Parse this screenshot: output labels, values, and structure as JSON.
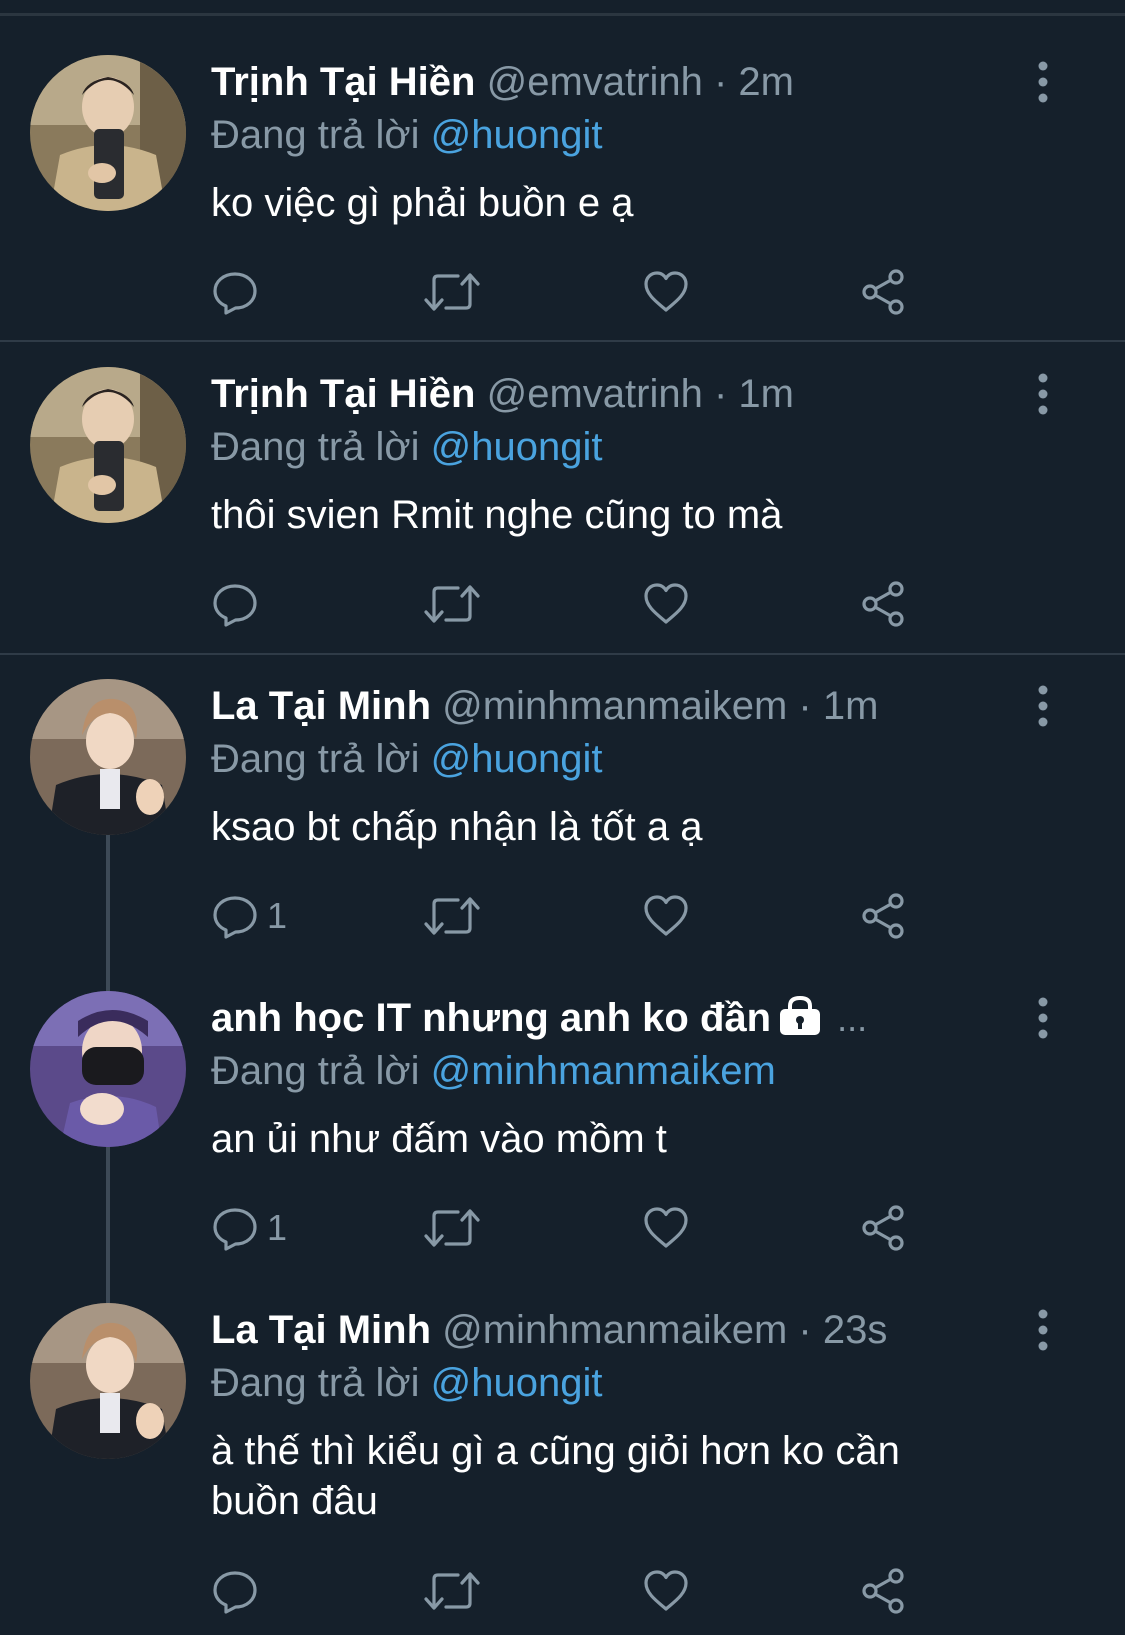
{
  "colors": {
    "background": "#15202b",
    "secondary_text": "#8899a6",
    "mention": "#4aa3df",
    "divider": "#2f3b47"
  },
  "icons": [
    "reply-icon",
    "retweet-icon",
    "like-icon",
    "share-icon",
    "more-icon",
    "lock-icon"
  ],
  "tweets": [
    {
      "display_name": "Trịnh Tại Hiền",
      "handle": "@emvatrinh",
      "separator": "·",
      "time": "2m",
      "replying_prefix": "Đang trả lời",
      "replying_to": "@huongit",
      "text": "ko việc gì phải buồn e ạ",
      "reply_count": ""
    },
    {
      "display_name": "Trịnh Tại Hiền",
      "handle": "@emvatrinh",
      "separator": "·",
      "time": "1m",
      "replying_prefix": "Đang trả lời",
      "replying_to": "@huongit",
      "text": "thôi svien Rmit nghe cũng to mà",
      "reply_count": ""
    },
    {
      "display_name": "La Tại Minh",
      "handle": "@minhmanmaikem",
      "separator": "·",
      "time": "1m",
      "replying_prefix": "Đang trả lời",
      "replying_to": "@huongit",
      "text": "ksao bt chấp nhận là tốt a ạ",
      "reply_count": "1"
    },
    {
      "display_name": "anh học IT nhưng anh ko đần",
      "truncation": "...",
      "replying_prefix": "Đang trả lời",
      "replying_to": "@minhmanmaikem",
      "text": "an ủi như đấm vào mồm t",
      "reply_count": "1"
    },
    {
      "display_name": "La Tại Minh",
      "handle": "@minhmanmaikem",
      "separator": "·",
      "time": "23s",
      "replying_prefix": "Đang trả lời",
      "replying_to": "@huongit",
      "text": "à thế thì kiểu gì a cũng giỏi hơn ko cần buồn đâu",
      "reply_count": ""
    }
  ]
}
